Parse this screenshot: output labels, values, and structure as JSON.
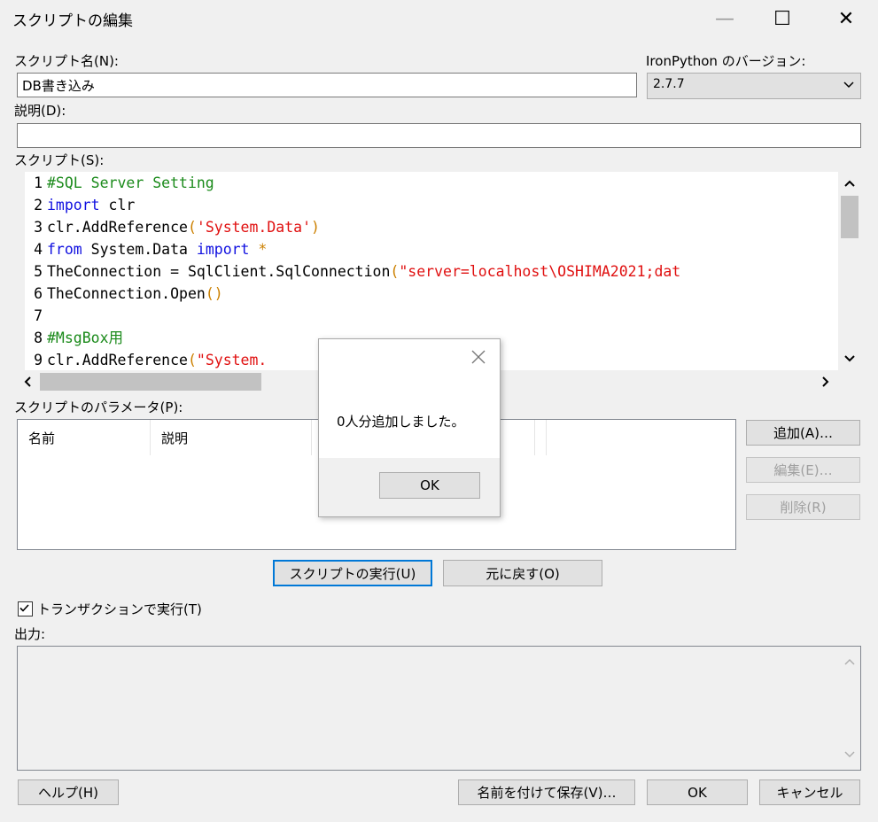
{
  "window": {
    "title": "スクリプトの編集",
    "minimize_glyph": "—",
    "maximize_glyph": "☐",
    "close_glyph": "✕"
  },
  "script_name": {
    "label": "スクリプト名(N):",
    "value": "DB書き込み"
  },
  "ironpython": {
    "label": "IronPython のバージョン:",
    "value": "2.7.7"
  },
  "description": {
    "label": "説明(D):",
    "value": ""
  },
  "script": {
    "label": "スクリプト(S):",
    "lines": [
      {
        "n": "1",
        "parts": [
          {
            "c": "cm",
            "t": "#SQL Server Setting"
          }
        ]
      },
      {
        "n": "2",
        "parts": [
          {
            "c": "kw",
            "t": "import"
          },
          {
            "c": "",
            "t": " clr"
          }
        ]
      },
      {
        "n": "3",
        "parts": [
          {
            "c": "",
            "t": "clr.AddReference"
          },
          {
            "c": "op",
            "t": "("
          },
          {
            "c": "st",
            "t": "'System.Data'"
          },
          {
            "c": "op",
            "t": ")"
          }
        ]
      },
      {
        "n": "4",
        "parts": [
          {
            "c": "kw",
            "t": "from"
          },
          {
            "c": "",
            "t": " System.Data "
          },
          {
            "c": "kw",
            "t": "import"
          },
          {
            "c": "op",
            "t": " *"
          }
        ]
      },
      {
        "n": "5",
        "parts": [
          {
            "c": "",
            "t": "TheConnection = SqlClient.SqlConnection"
          },
          {
            "c": "op",
            "t": "("
          },
          {
            "c": "st",
            "t": "\"server=localhost\\OSHIMA2021;dat"
          }
        ]
      },
      {
        "n": "6",
        "parts": [
          {
            "c": "",
            "t": "TheConnection.Open"
          },
          {
            "c": "op",
            "t": "()"
          }
        ]
      },
      {
        "n": "7",
        "parts": []
      },
      {
        "n": "8",
        "parts": [
          {
            "c": "cm",
            "t": "#MsgBox用"
          }
        ]
      },
      {
        "n": "9",
        "parts": [
          {
            "c": "",
            "t": "clr.AddReference"
          },
          {
            "c": "op",
            "t": "("
          },
          {
            "c": "st",
            "t": "\"System."
          }
        ]
      }
    ]
  },
  "parameters": {
    "label": "スクリプトのパラメータ(P):",
    "columns": [
      "名前",
      "説明",
      "",
      ""
    ],
    "add_label": "追加(A)…",
    "edit_label": "編集(E)…",
    "delete_label": "削除(R)"
  },
  "run_label": "スクリプトの実行(U)",
  "revert_label": "元に戻す(O)",
  "transaction": {
    "label": "トランザクションで実行(T)",
    "checked": true
  },
  "output": {
    "label": "出力:"
  },
  "footer": {
    "help_label": "ヘルプ(H)",
    "save_as_label": "名前を付けて保存(V)…",
    "ok_label": "OK",
    "cancel_label": "キャンセル"
  },
  "messagebox": {
    "message": "0人分追加しました。",
    "ok_label": "OK"
  },
  "colors": {
    "keyword": "#1010e0",
    "comment": "#1a8a1a",
    "string": "#e01010",
    "operator": "#cc8000",
    "focus": "#0078d7"
  }
}
